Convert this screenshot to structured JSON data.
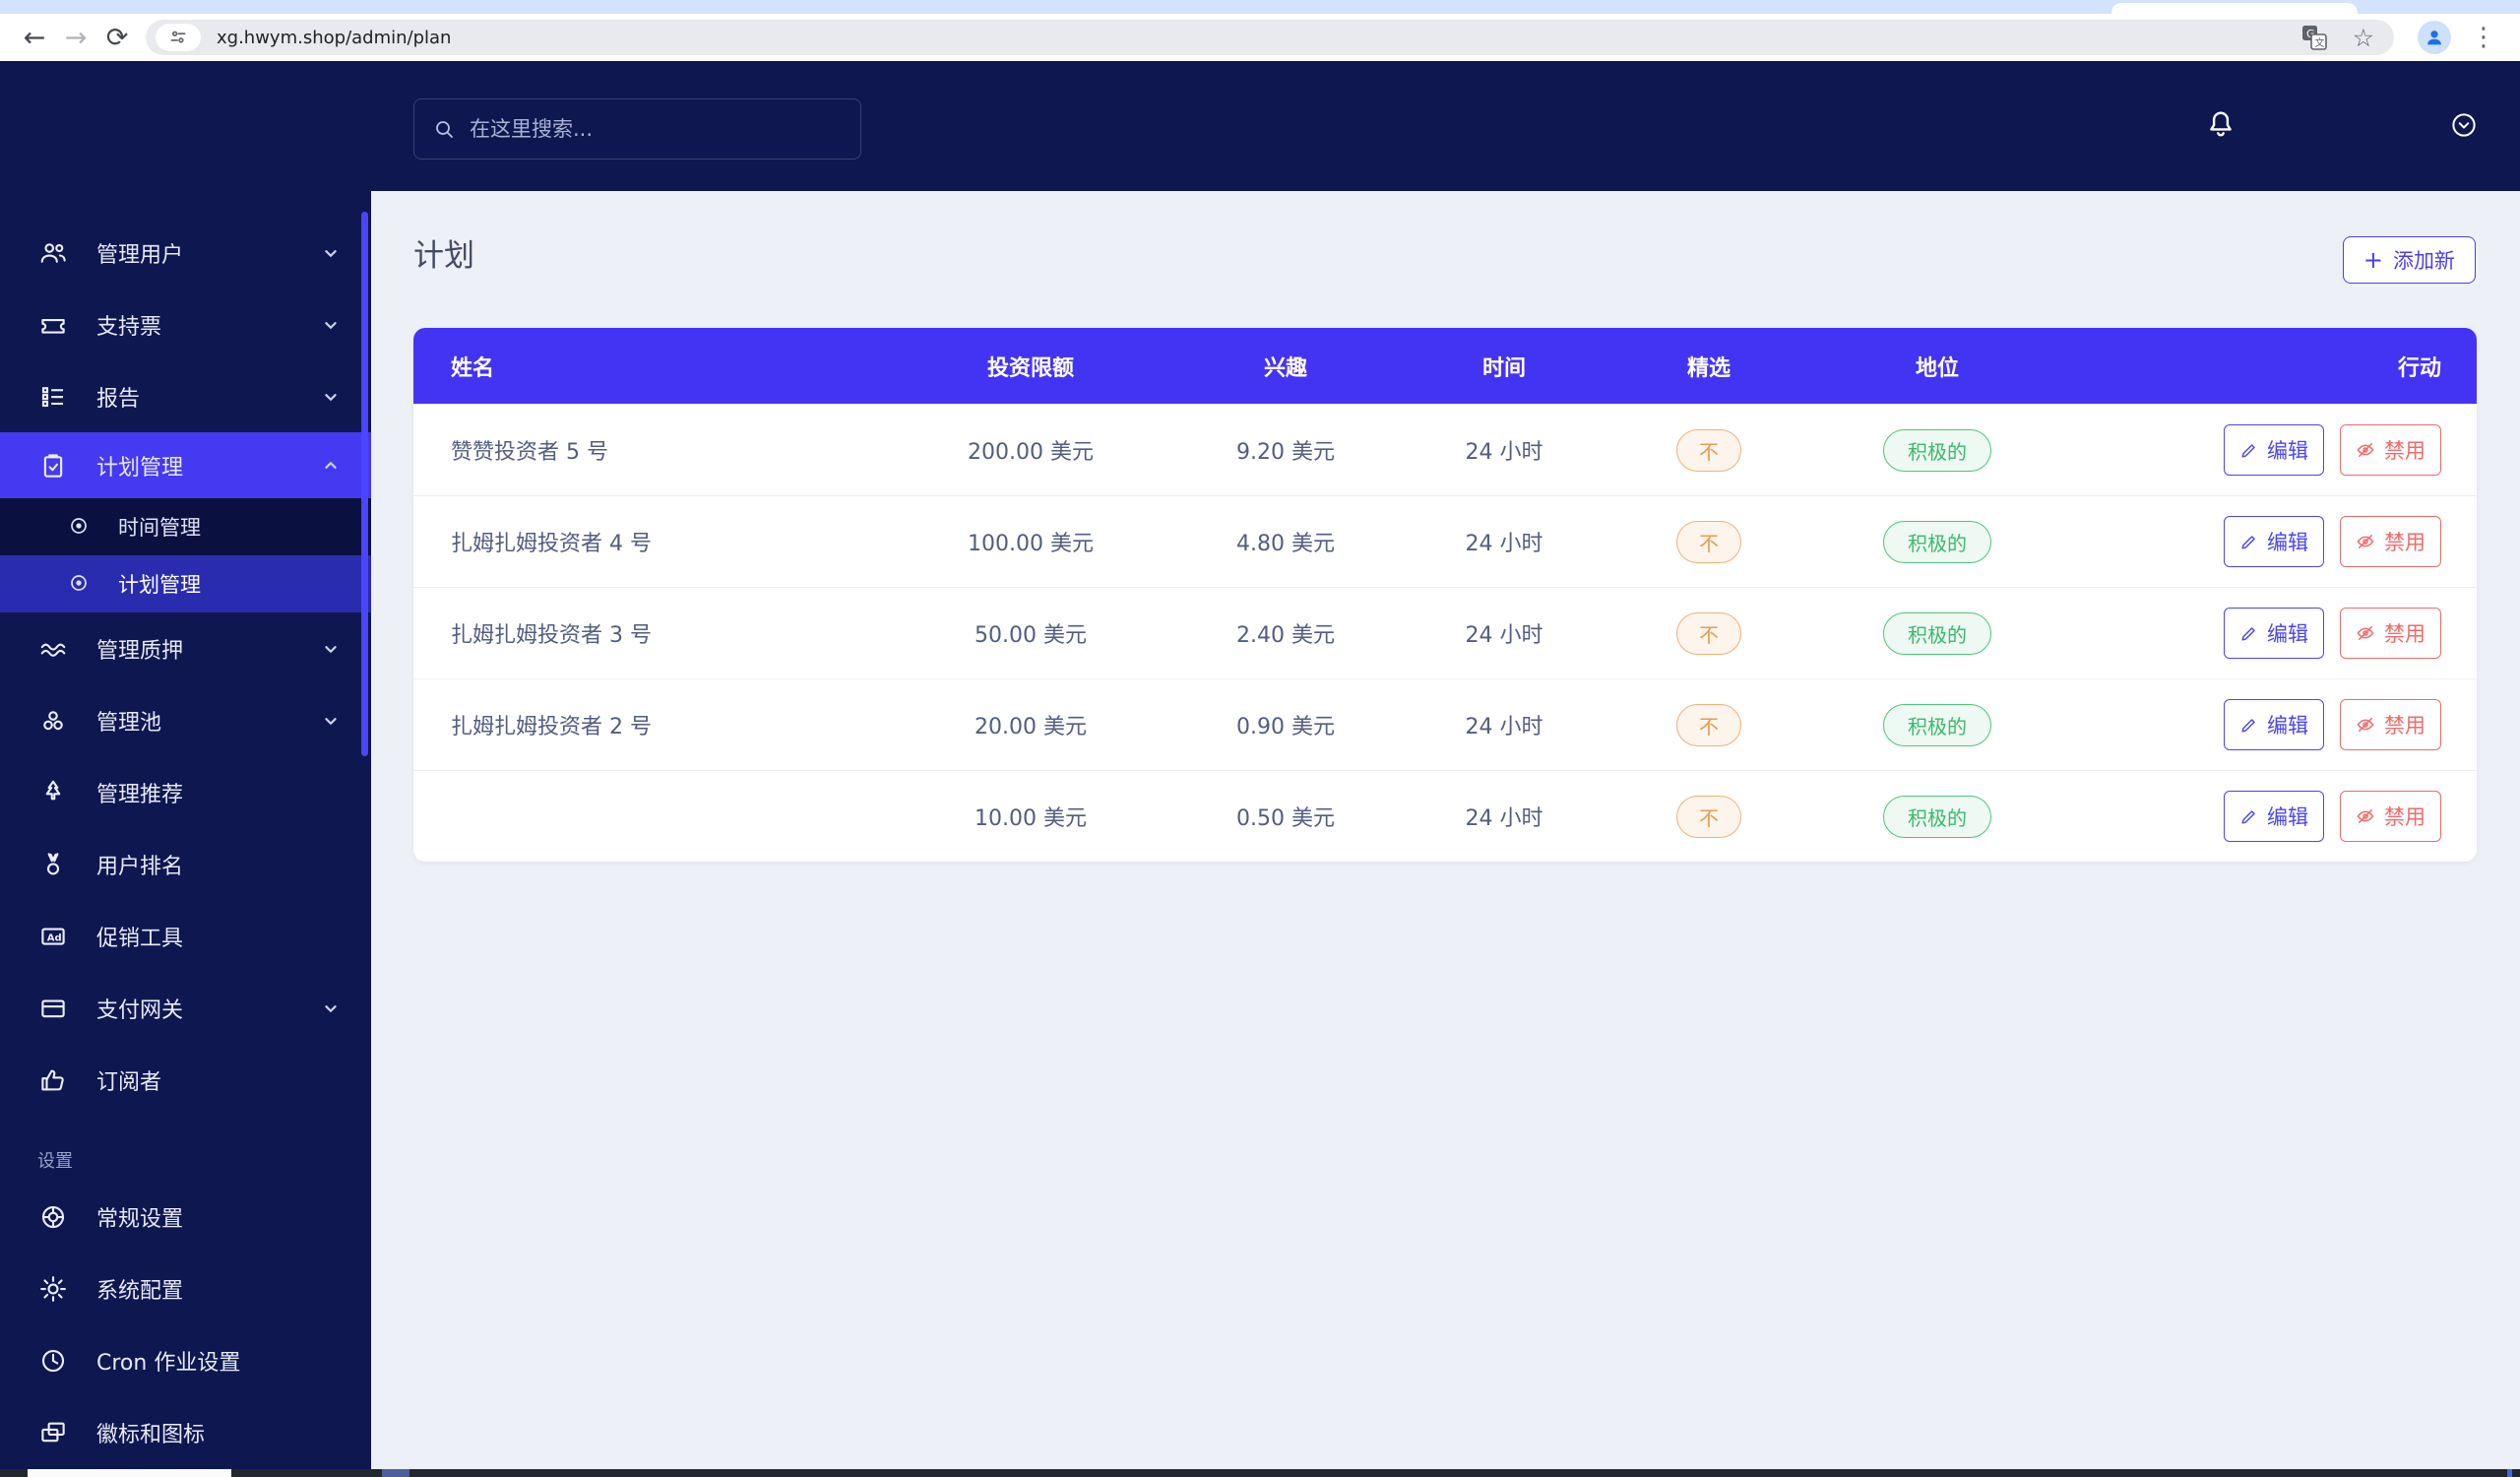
{
  "browser": {
    "url": "xg.hwym.shop/admin/plan",
    "icons": {
      "back": "←",
      "forward": "→",
      "reload": "⟳",
      "star": "☆",
      "dots": "⋮"
    }
  },
  "topbar": {
    "search_placeholder": "在这里搜索..."
  },
  "sidebar": {
    "items": [
      {
        "label": "管理用户"
      },
      {
        "label": "支持票"
      },
      {
        "label": "报告"
      },
      {
        "label": "计划管理"
      },
      {
        "label": "时间管理"
      },
      {
        "label": "计划管理"
      },
      {
        "label": "管理质押"
      },
      {
        "label": "管理池"
      },
      {
        "label": "管理推荐"
      },
      {
        "label": "用户排名"
      },
      {
        "label": "促销工具"
      },
      {
        "label": "支付网关"
      },
      {
        "label": "订阅者"
      },
      {
        "label": "常规设置"
      },
      {
        "label": "系统配置"
      },
      {
        "label": "Cron 作业设置"
      },
      {
        "label": "徽标和图标"
      }
    ],
    "section_label": "设置"
  },
  "page": {
    "title": "计划",
    "add_plus": "+",
    "add_label": "添加新"
  },
  "table": {
    "headers": [
      "姓名",
      "投资限额",
      "兴趣",
      "时间",
      "精选",
      "地位",
      "行动"
    ],
    "actions": {
      "edit": "编辑",
      "disable": "禁用"
    },
    "rows": [
      {
        "name": "赞赞投资者 5 号",
        "limit": "200.00 美元",
        "interest": "9.20 美元",
        "time": "24 小时",
        "featured": "不",
        "status": "积极的"
      },
      {
        "name": "扎姆扎姆投资者 4 号",
        "limit": "100.00 美元",
        "interest": "4.80 美元",
        "time": "24 小时",
        "featured": "不",
        "status": "积极的"
      },
      {
        "name": "扎姆扎姆投资者 3 号",
        "limit": "50.00 美元",
        "interest": "2.40 美元",
        "time": "24 小时",
        "featured": "不",
        "status": "积极的"
      },
      {
        "name": "扎姆扎姆投资者 2 号",
        "limit": "20.00 美元",
        "interest": "0.90 美元",
        "time": "24 小时",
        "featured": "不",
        "status": "积极的"
      },
      {
        "name": "",
        "limit": "10.00 美元",
        "interest": "0.50 美元",
        "time": "24 小时",
        "featured": "不",
        "status": "积极的"
      }
    ]
  },
  "colors": {
    "accent": "#4334f4",
    "sidebar_bg": "#0e1750",
    "active_item": "#4539f2",
    "active_sub": "#2a2caf",
    "featured_badge": "#e99a50",
    "status_badge": "#3cb96a",
    "edit_btn": "#4a44f2",
    "disable_btn": "#ef6a6a",
    "content_bg": "#eef0f7",
    "tabstrip": "#d3e3fd"
  }
}
